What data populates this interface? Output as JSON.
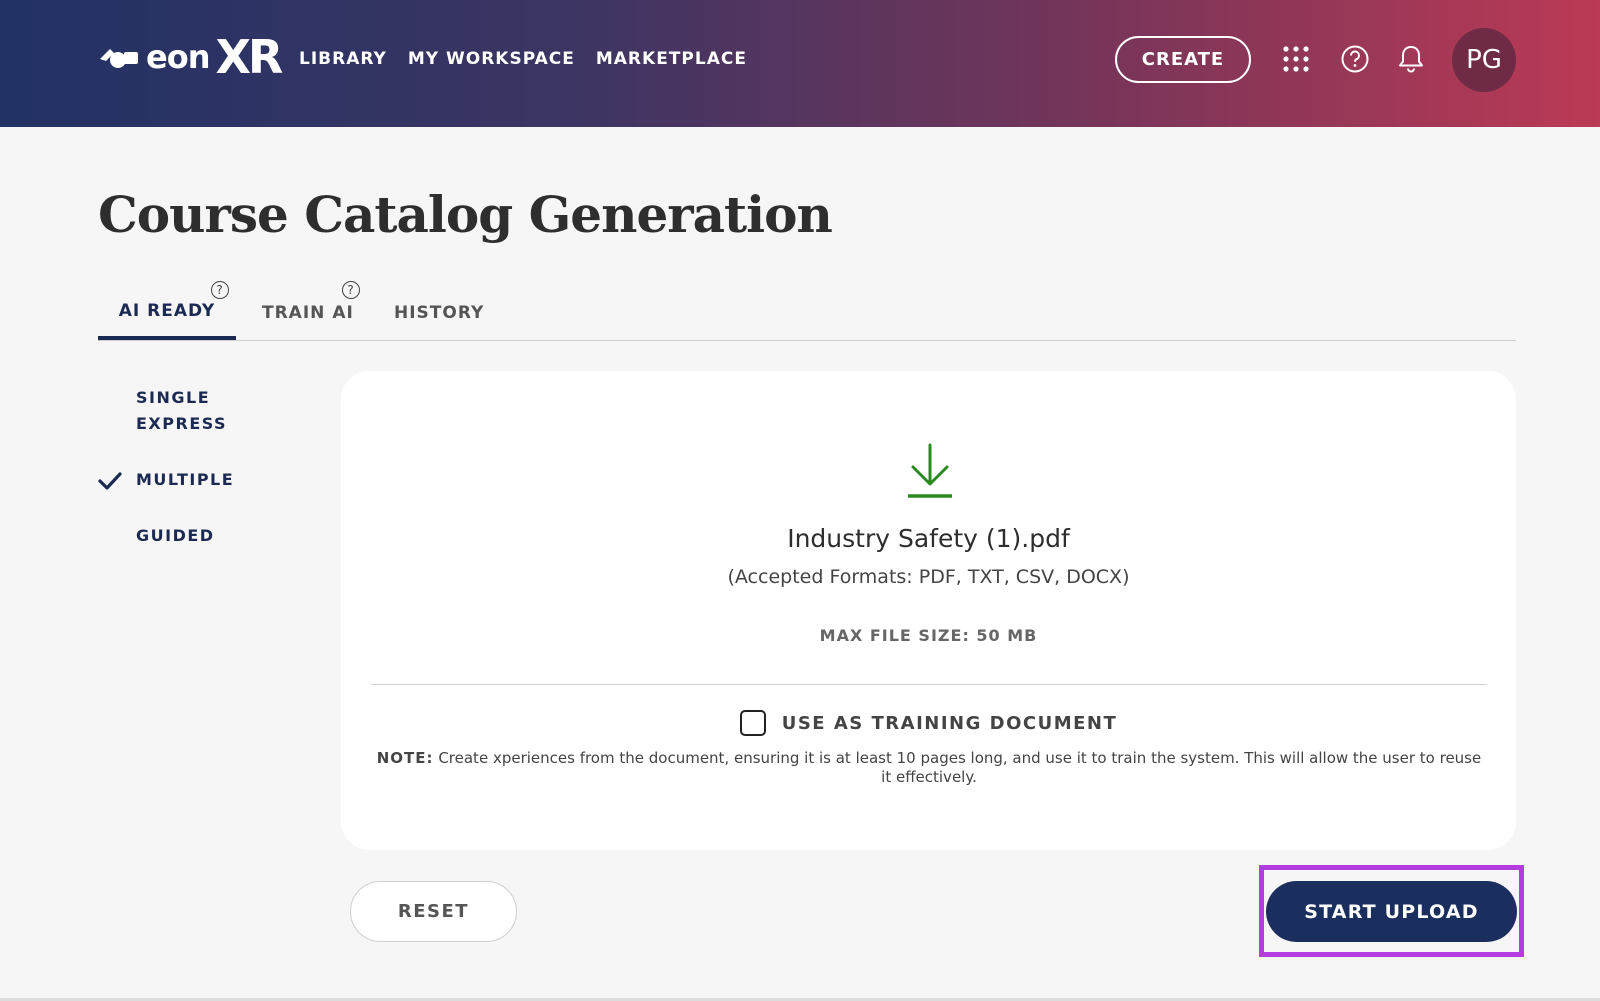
{
  "header": {
    "logo_text": "eon",
    "logo_xr": "XR",
    "nav": [
      "LIBRARY",
      "MY WORKSPACE",
      "MARKETPLACE"
    ],
    "create_label": "CREATE",
    "avatar_initials": "PG",
    "icons": [
      "apps-grid-icon",
      "help-icon",
      "bell-icon"
    ]
  },
  "page": {
    "title": "Course Catalog Generation"
  },
  "tabs": [
    {
      "label": "AI READY",
      "active": true,
      "help_icon": true
    },
    {
      "label": "TRAIN AI",
      "active": false,
      "help_icon": true
    },
    {
      "label": "HISTORY",
      "active": false,
      "help_icon": false
    }
  ],
  "side_options": [
    {
      "label_line1": "SINGLE",
      "label_line2": "EXPRESS",
      "selected": false
    },
    {
      "label": "MULTIPLE",
      "selected": true
    },
    {
      "label": "GUIDED",
      "selected": false
    }
  ],
  "upload": {
    "file_name": "Industry Safety (1).pdf",
    "accepted_formats": "(Accepted Formats: PDF, TXT, CSV, DOCX)",
    "max_file_size": "MAX FILE SIZE: 50 MB",
    "training_checkbox_label": "USE AS TRAINING DOCUMENT",
    "training_checked": false,
    "note_label": "NOTE:",
    "note_text": "Create xperiences from the document, ensuring it is at least 10 pages long, and use it to train the system. This will allow the user to reuse it effectively."
  },
  "buttons": {
    "reset": "RESET",
    "start_upload": "START UPLOAD"
  },
  "colors": {
    "accent": "#1b2f5e",
    "highlight": "#b43ce0",
    "download_icon": "#2b8a1f"
  }
}
